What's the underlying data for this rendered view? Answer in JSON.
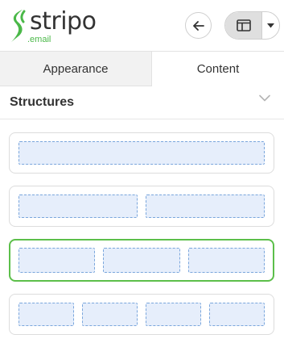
{
  "brand": {
    "name": "stripo",
    "sub": ".email",
    "accent": "#4ab848"
  },
  "toolbar": {
    "back_icon": "arrow-left-icon",
    "view_icon": "layout-panel-icon",
    "dropdown_icon": "caret-down-icon"
  },
  "tabs": [
    {
      "label": "Appearance",
      "active": false
    },
    {
      "label": "Content",
      "active": true
    }
  ],
  "section": {
    "title": "Structures",
    "chevron_icon": "chevron-down-icon"
  },
  "structures": [
    {
      "columns": 1,
      "selected": false
    },
    {
      "columns": 2,
      "selected": false
    },
    {
      "columns": 3,
      "selected": true
    },
    {
      "columns": 4,
      "selected": false
    }
  ],
  "colors": {
    "selected_border": "#5cbf4a",
    "column_fill": "#e6eefb",
    "column_border": "#7aa6dc"
  }
}
